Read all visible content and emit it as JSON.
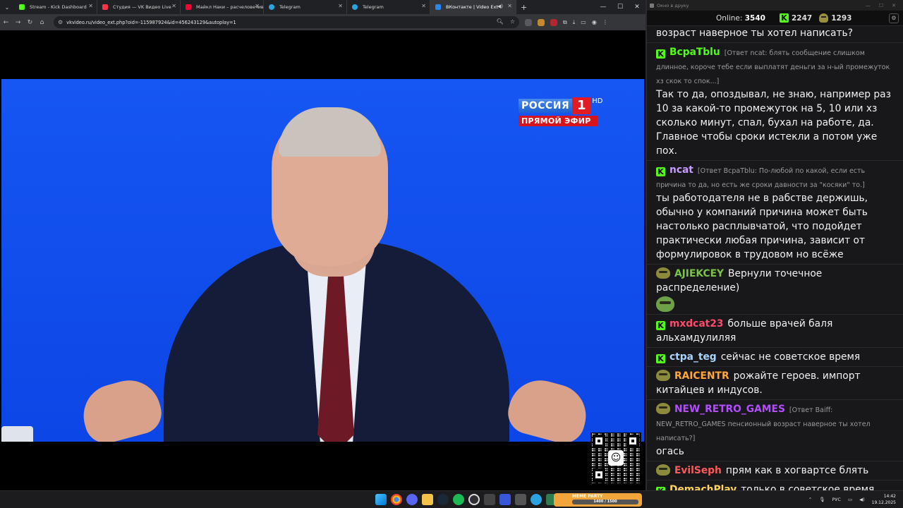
{
  "browser": {
    "tabs": [
      {
        "title": "Stream - Kick Dashboard",
        "favicon_color": "#53fc18",
        "active": false
      },
      {
        "title": "Студия — VK Видео Live",
        "favicon_color": "#ff3347",
        "active": false
      },
      {
        "title": "Майкл Наки – расчеловечивание",
        "favicon_color": "#ff0033",
        "active": false
      },
      {
        "title": "Telegram",
        "favicon_color": "#2aa3df",
        "active": false
      },
      {
        "title": "Telegram",
        "favicon_color": "#2aa3df",
        "active": false
      },
      {
        "title": "ВКонтакте | Video Ext",
        "favicon_color": "#2787f5",
        "active": true
      }
    ],
    "new_tab": "+",
    "window_controls": {
      "minimize": "—",
      "maximize": "☐",
      "close": "✕"
    },
    "address": {
      "url": "vkvideo.ru/video_ext.php?oid=-115987924&id=456243129&autoplay=1"
    }
  },
  "video": {
    "channel_logo": {
      "name": "РОССИЯ",
      "number": "1",
      "hd": "HD",
      "live_label": "ПРЯМОЙ ЭФИР"
    }
  },
  "chat_window": {
    "title": "Окно в друку",
    "stats": {
      "online_label": "Online:",
      "online_count": "3540",
      "kick_count": "2247",
      "second_count": "1293"
    },
    "messages": [
      {
        "user": "",
        "badge": "none",
        "user_color": "#f1f1f1",
        "reply": "",
        "text": "возраст наверное ты хотел написать?"
      },
      {
        "user": "ВсраТblu",
        "badge": "kick",
        "user_color": "#53fc18",
        "reply": "[Ответ ncat: блять сообщение слишком длинное, короче тебе если выплатят деньги за н-ый промежуток хз скок то спок...]",
        "text": "Так то да, опоздывал, не знаю, например раз 10 за какой-то промежуток на 5, 10 или хз сколько минут, спал, бухал на работе, да. Главное чтобы сроки истекли а потом уже пох."
      },
      {
        "user": "ncat",
        "badge": "kick",
        "user_color": "#c79bff",
        "reply": "[Ответ ВсраТblu: По-любой по какой, если есть причина то да, но есть же сроки давности за \"косяки\" то.]",
        "text": "ты работодателя не в рабстве держишь, обычно у компаний причина может быть настолько расплывчатой, что подойдет практически любая причина, зависит от формулировок в трудовом но всёже"
      },
      {
        "user": "AJIEKCEY",
        "badge": "pepe",
        "user_color": "#7bc24a",
        "reply": "",
        "text": "Вернули точечное распределение)"
      },
      {
        "user": "mxdcat23",
        "badge": "kick",
        "user_color": "#ff4a6d",
        "reply": "",
        "text": "больше врачей баля альхамдулиляя"
      },
      {
        "user": "ctpa_teg",
        "badge": "kick",
        "user_color": "#a9d4ff",
        "reply": "",
        "text": "сейчас не советское время"
      },
      {
        "user": "RAICENTR",
        "badge": "pepe",
        "user_color": "#ffa63b",
        "reply": "",
        "text": "рожайте героев. импорт китайцев и индусов."
      },
      {
        "user": "NEW_RETRO_GAMES",
        "badge": "pepe",
        "user_color": "#b44cff",
        "reply": "[Ответ Baiff: NEW_RETRO_GAMES пенсионный возраст наверное ты хотел написать?]",
        "text": "огась"
      },
      {
        "user": "EvilSeph",
        "badge": "pepe",
        "user_color": "#ff5a5a",
        "reply": "",
        "text": "прям как в хогвартсе блять"
      },
      {
        "user": "DemachPlay",
        "badge": "kick",
        "user_color": "#ffd35c",
        "reply": "",
        "text": "только в советское время было намного больше льгот и эти льготы были реально, ощутимо полезные."
      }
    ]
  },
  "taskbar": {
    "media_widget": {
      "title": "MEME PARTY",
      "progress": "1400 / 1500"
    },
    "tray": {
      "language": "РУС",
      "time": "14:42",
      "date": "19.12.2025"
    }
  }
}
